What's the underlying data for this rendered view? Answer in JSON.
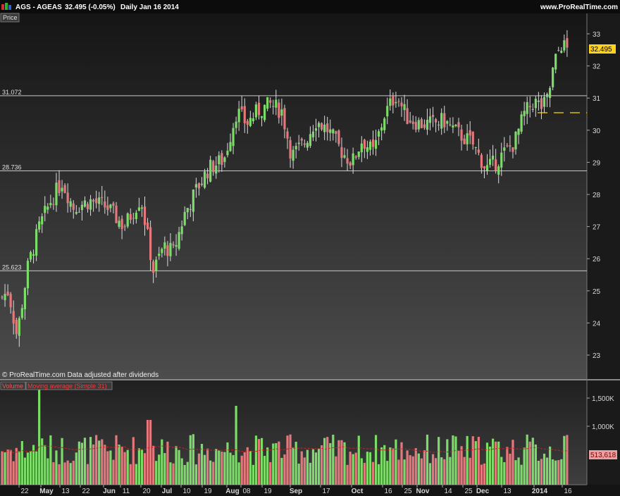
{
  "header": {
    "instrument": "AGS - AGEAS",
    "last_change": "32.495 (-0.05%)",
    "period_date": "Daily  Jan 16 2014",
    "website": "www.ProRealTime.com"
  },
  "price_panel": {
    "label": "Price",
    "footer": "© ProRealTime.com  Data adjusted after dividends"
  },
  "volume_panel": {
    "label": "Volume",
    "indicator_label": "Moving average (Simple 31)"
  },
  "colors": {
    "up": "#7ddb6a",
    "down": "#e4787c",
    "background_top": "#151515",
    "background_bottom": "#4a4a4a",
    "level_line": "#c8c8c8",
    "marker": "#ffd700",
    "ma_line": "#d02020"
  },
  "chart_data": [
    {
      "type": "candlestick",
      "title": "AGS - AGEAS",
      "y_axis": {
        "range": [
          22.9,
          33.4
        ],
        "ticks": [
          23,
          24,
          25,
          26,
          27,
          28,
          29,
          30,
          31,
          32,
          33
        ]
      },
      "x_axis": {
        "tick_labels": [
          "22",
          "May",
          "13",
          "22",
          "Jun",
          "11",
          "20",
          "Jul",
          "10",
          "19",
          "Aug",
          "08",
          "19",
          "Sep",
          "17",
          "Oct",
          "16",
          "25",
          "Nov",
          "14",
          "25",
          "Dec",
          "13",
          "2014",
          "16"
        ],
        "month_labels": [
          "May",
          "Jun",
          "Jul",
          "Aug",
          "Sep",
          "Oct",
          "Nov",
          "Dec",
          "2014"
        ]
      },
      "last_price": "32.495",
      "horizontal_levels": [
        {
          "value": 31.072,
          "label": "31.072"
        },
        {
          "value": 28.736,
          "label": "28.736"
        },
        {
          "value": 25.623,
          "label": "25.623"
        }
      ],
      "key_points": [
        {
          "x": "Apr 17",
          "close": 24.8
        },
        {
          "x": "Apr 23",
          "low": 23.4
        },
        {
          "x": "Apr 30",
          "close": 25.8
        },
        {
          "x": "May 03",
          "close": 27.0
        },
        {
          "x": "May 13",
          "high": 28.7,
          "close": 28.4
        },
        {
          "x": "Jun 11",
          "close": 27.6
        },
        {
          "x": "Jun 25",
          "low": 25.3
        },
        {
          "x": "Jul 10",
          "close": 27.3
        },
        {
          "x": "Jul 24",
          "close": 28.8
        },
        {
          "x": "Aug 05",
          "high": 31.0,
          "close": 30.6
        },
        {
          "x": "Aug 30",
          "high": 30.9
        },
        {
          "x": "Sep 03",
          "low": 28.8
        },
        {
          "x": "Sep 24",
          "close": 29.3
        },
        {
          "x": "Oct 14",
          "close": 30.7
        },
        {
          "x": "Oct 21",
          "high": 31.3
        },
        {
          "x": "Nov 14",
          "close": 30.1
        },
        {
          "x": "Dec 05",
          "low": 28.5
        },
        {
          "x": "Dec 20",
          "close": 29.5
        },
        {
          "x": "Dec 27",
          "close": 30.5
        },
        {
          "x": "Jan 06",
          "close": 30.9
        },
        {
          "x": "Jan 13",
          "high": 33.1,
          "close": 32.7
        },
        {
          "x": "Jan 16",
          "close": 32.495
        }
      ],
      "annotation": "© ProRealTime.com  Data adjusted after dividends"
    },
    {
      "type": "bar",
      "title": "Volume",
      "y_axis": {
        "ticks": [
          "1,000K",
          "1,500K"
        ]
      },
      "moving_average_label": "Moving average (Simple 31)",
      "moving_average_last": "513,618",
      "peaks": [
        {
          "x": "May 01",
          "value": 1700000
        },
        {
          "x": "Aug 05",
          "value": 1400000
        }
      ]
    }
  ]
}
